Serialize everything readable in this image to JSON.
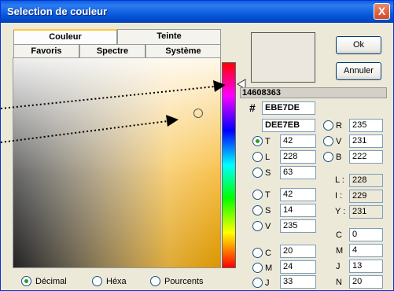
{
  "window": {
    "title": "Selection de couleur",
    "close_glyph": "X"
  },
  "tabs": [
    {
      "label": "Couleur"
    },
    {
      "label": "Teinte"
    },
    {
      "label": "Favoris"
    },
    {
      "label": "Spectre"
    },
    {
      "label": "Système"
    }
  ],
  "buttons": {
    "ok": "Ok",
    "cancel": "Annuler"
  },
  "color_value_dec": "14608363",
  "hash_symbol": "#",
  "hex_main": "EBE7DE",
  "hex_alt": "DEE7EB",
  "rgb": [
    {
      "label": "R",
      "value": "235"
    },
    {
      "label": "V",
      "value": "231"
    },
    {
      "label": "B",
      "value": "222"
    }
  ],
  "tls": [
    {
      "label": "T",
      "value": "42"
    },
    {
      "label": "L",
      "value": "228"
    },
    {
      "label": "S",
      "value": "63"
    }
  ],
  "tsv": [
    {
      "label": "T",
      "value": "42"
    },
    {
      "label": "S",
      "value": "14"
    },
    {
      "label": "V",
      "value": "235"
    }
  ],
  "lab_like": [
    {
      "label": "L :",
      "value": "228"
    },
    {
      "label": "I :",
      "value": "229"
    },
    {
      "label": "Y :",
      "value": "231"
    }
  ],
  "cmj_left": [
    {
      "label": "C",
      "value": "20"
    },
    {
      "label": "M",
      "value": "24"
    },
    {
      "label": "J",
      "value": "33"
    }
  ],
  "cmjn_right": [
    {
      "label": "C",
      "value": "0"
    },
    {
      "label": "M",
      "value": "4"
    },
    {
      "label": "J",
      "value": "13"
    },
    {
      "label": "N",
      "value": "20"
    }
  ],
  "format_options": [
    "Décimal",
    "Héxa",
    "Pourcents"
  ],
  "colors": {
    "title_bar": "#0553d8",
    "selected_swatch": "#ebe7de"
  },
  "icons": {
    "cursor": "circle-cursor-icon",
    "slider": "triangle-marker-icon"
  }
}
